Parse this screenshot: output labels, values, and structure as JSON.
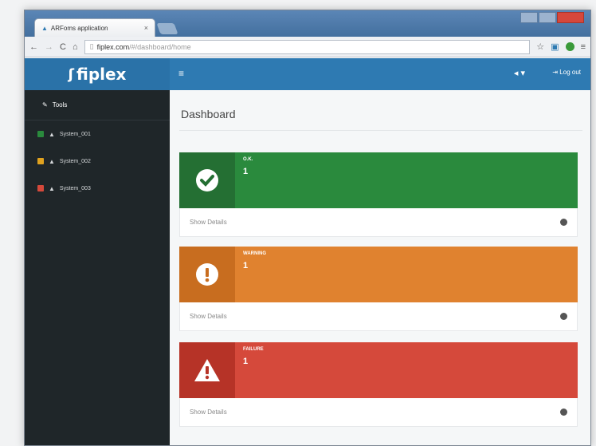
{
  "browser": {
    "tab_title": "ARFoms application",
    "tab_close": "×",
    "url_host": "fiplex.com",
    "url_path": "/#/dashboard/home"
  },
  "app": {
    "logo_text": "fiplex",
    "logout_label": "Log out",
    "brand_color": "#2e7ab2"
  },
  "sidebar": {
    "tools_label": "Tools",
    "items": [
      {
        "label": "System_001",
        "status_color": "#2a8a3d"
      },
      {
        "label": "System_002",
        "status_color": "#e0a21f"
      },
      {
        "label": "System_003",
        "status_color": "#d5493b"
      }
    ]
  },
  "main": {
    "title": "Dashboard",
    "panels": [
      {
        "label": "O.K.",
        "count": "1",
        "footer": "Show Details",
        "color": "#2a8a3d"
      },
      {
        "label": "WARNING",
        "count": "1",
        "footer": "Show Details",
        "color": "#e0822f"
      },
      {
        "label": "FAILURE",
        "count": "1",
        "footer": "Show Details",
        "color": "#d5493b"
      }
    ]
  }
}
